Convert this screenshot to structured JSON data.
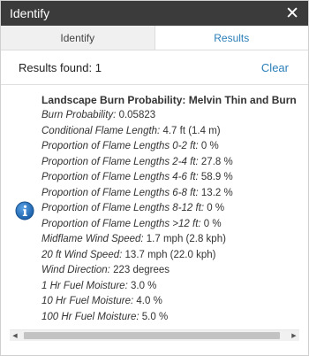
{
  "window": {
    "title": "Identify",
    "close_glyph": "✕"
  },
  "tabs": [
    {
      "label": "Identify",
      "active": false
    },
    {
      "label": "Results",
      "active": true
    }
  ],
  "summary": {
    "count_text": "Results found: 1",
    "clear_label": "Clear"
  },
  "result": {
    "icon": "info-icon",
    "name": "Landscape Burn Probability: Melvin Thin and Burn",
    "attributes": [
      {
        "key": "Burn Probability:",
        "value": " 0.05823"
      },
      {
        "key": "Conditional Flame Length:",
        "value": " 4.7 ft (1.4 m)"
      },
      {
        "key": "Proportion of Flame Lengths 0-2 ft:",
        "value": " 0 %"
      },
      {
        "key": "Proportion of Flame Lengths 2-4 ft:",
        "value": " 27.8 %"
      },
      {
        "key": "Proportion of Flame Lengths 4-6 ft:",
        "value": " 58.9 %"
      },
      {
        "key": "Proportion of Flame Lengths 6-8 ft:",
        "value": " 13.2 %"
      },
      {
        "key": "Proportion of Flame Lengths 8-12 ft:",
        "value": " 0 %"
      },
      {
        "key": "Proportion of Flame Lengths >12 ft:",
        "value": " 0 %"
      },
      {
        "key": "Midflame Wind Speed:",
        "value": " 1.7 mph (2.8 kph)"
      },
      {
        "key": "20 ft Wind Speed:",
        "value": " 13.7 mph (22.0 kph)"
      },
      {
        "key": "Wind Direction:",
        "value": " 223 degrees"
      },
      {
        "key": "1 Hr Fuel Moisture:",
        "value": " 3.0 %"
      },
      {
        "key": "10 Hr Fuel Moisture:",
        "value": " 4.0 %"
      },
      {
        "key": "100 Hr Fuel Moisture:",
        "value": " 5.0 %"
      }
    ]
  },
  "colors": {
    "titlebar": "#3b3b3b",
    "accent": "#2b7fb8",
    "info_icon": "#1f6fb5"
  }
}
